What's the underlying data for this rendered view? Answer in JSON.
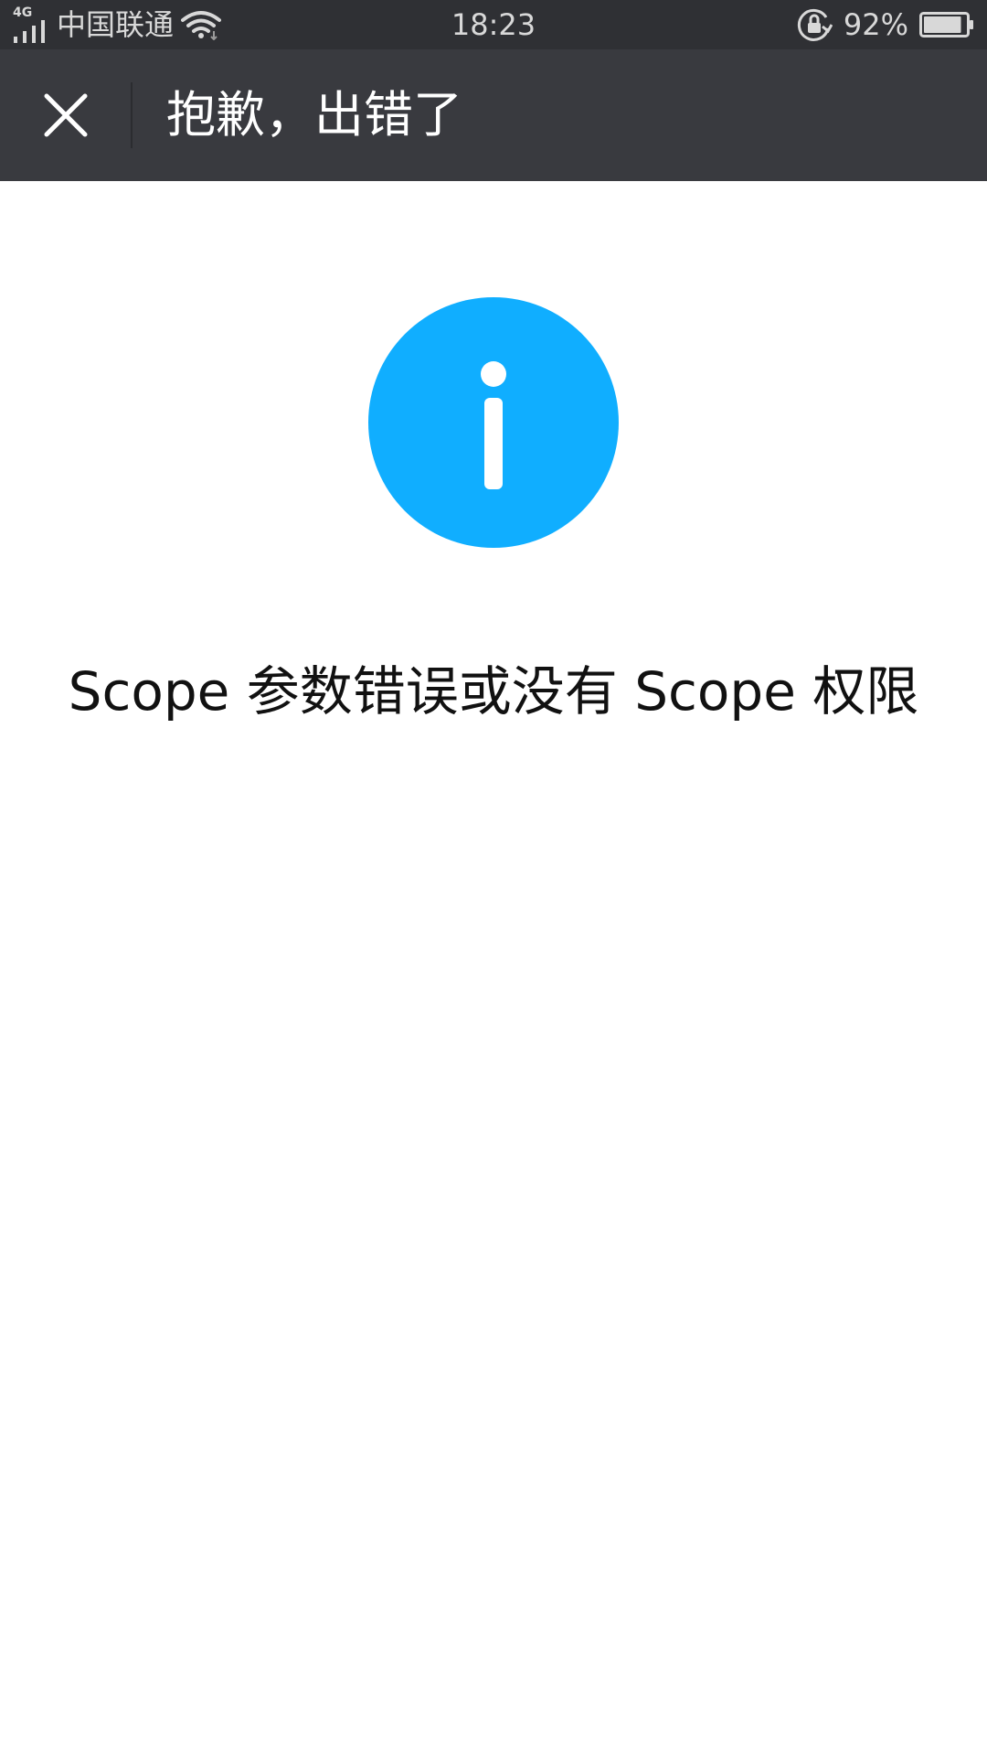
{
  "status_bar": {
    "network_type": "4G",
    "carrier": "中国联通",
    "time": "18:23",
    "battery_percent": "92%",
    "battery_level": 0.92,
    "icons": [
      "signal-icon",
      "wifi-icon",
      "rotation-lock-icon",
      "battery-icon"
    ]
  },
  "header": {
    "title": "抱歉，出错了",
    "close_icon": "close-icon"
  },
  "main": {
    "icon": "info-icon",
    "icon_color": "#10aeff",
    "message": "Scope 参数错误或没有 Scope 权限"
  },
  "colors": {
    "status_bar_bg": "#2f3034",
    "header_bg": "#393a3f",
    "page_bg": "#ffffff"
  }
}
